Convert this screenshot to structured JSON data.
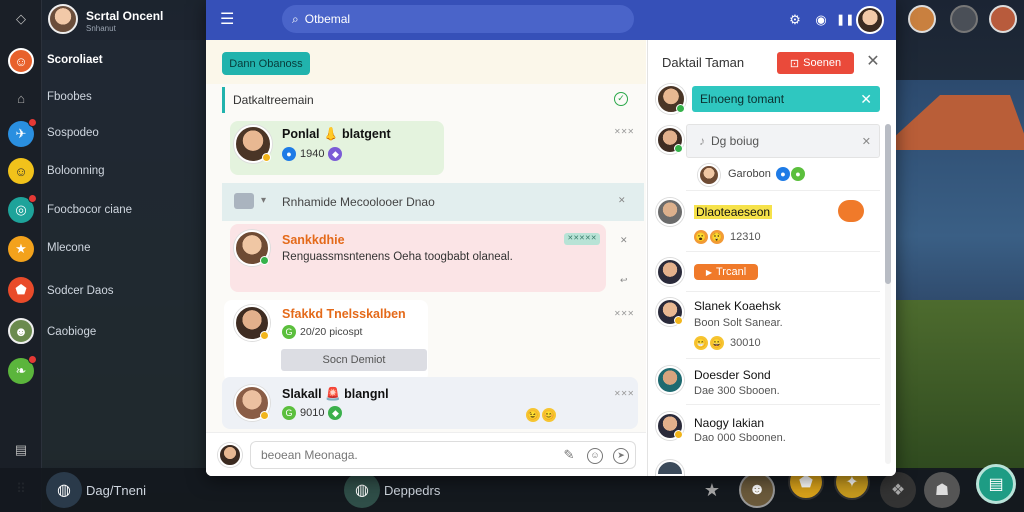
{
  "user": {
    "name": "Scrtal Oncenl",
    "sub": "Snhanut"
  },
  "sidebar": {
    "items": [
      {
        "label": "Scoroliaet",
        "icon": "avatar-icon",
        "active": true
      },
      {
        "label": "Fboobes",
        "icon": "home-icon"
      },
      {
        "label": "Sospodeo",
        "icon": "rocket-icon"
      },
      {
        "label": "Boloonning",
        "icon": "smile-icon"
      },
      {
        "label": "Foocbocor ciane",
        "icon": "compass-icon"
      },
      {
        "label": "Mlecone",
        "icon": "star-icon"
      },
      {
        "label": "Sodcer Daos",
        "icon": "shield-icon"
      },
      {
        "label": "Caobioge",
        "icon": "profile-icon"
      }
    ]
  },
  "topbar": {
    "search_placeholder": "Otbemal"
  },
  "chat": {
    "header_button": "Dann Obanoss",
    "filter_label": "Datkaltreemain",
    "messages": [
      {
        "name": "Ponlal 👃 blatgent",
        "count": "1940",
        "time": "✕✕✕"
      },
      {
        "section": "Rnhamide Mecoolooer Dnao"
      },
      {
        "name": "Sankkdhie",
        "text": "Renguassmsntenens Oeha toogbabt olaneal.",
        "tag": "✕✕✕✕✕"
      },
      {
        "name": "Sfakkd Tnelsskalben",
        "sub": "20/20 picospt",
        "button": "Socn Demiot",
        "time": "✕✕✕"
      },
      {
        "name": "Slakall 🚨 blangnl",
        "count": "9010",
        "time": "✕✕✕"
      }
    ],
    "compose_placeholder": "beoean Meonaga."
  },
  "panel": {
    "title": "Daktail Taman",
    "red_button": "Soenen",
    "teal_bar": "Elnoeng tomant",
    "box_label": "Dg boiug",
    "group_label": "Garobon",
    "entries": [
      {
        "highlight": "Dlaoteaeseon",
        "count": "12310"
      },
      {
        "tag": "Trcanl"
      },
      {
        "name": "Slanek Koaehsk",
        "sub": "Boon Solt Sanear.",
        "count": "30010"
      },
      {
        "name": "Doesder Sond",
        "sub": "Dae 300 Sbooen."
      },
      {
        "name": "Naogy Iakian",
        "sub": "Dao 000 Sboonen."
      }
    ]
  },
  "bottom": {
    "left_label": "Dag/Tneni",
    "mid_label": "Deppedrs"
  }
}
